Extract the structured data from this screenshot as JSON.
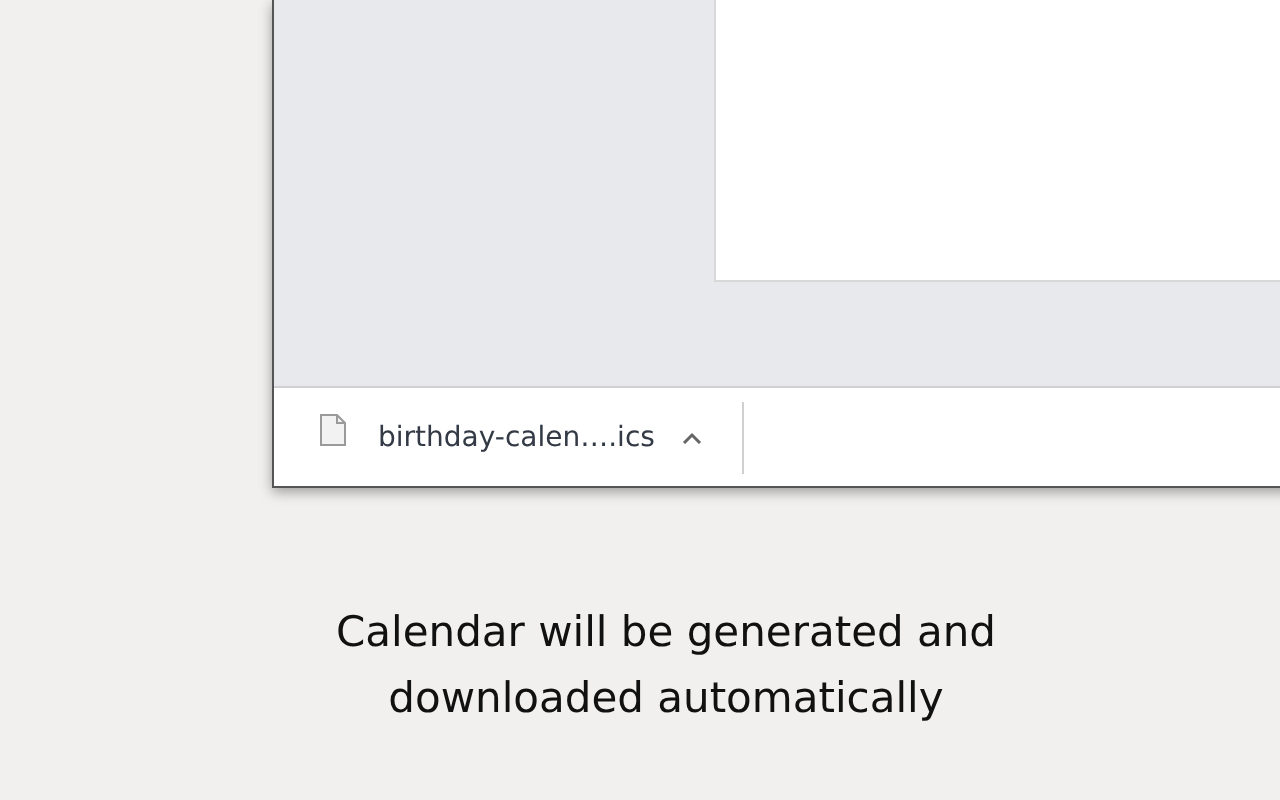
{
  "download_bar": {
    "items": [
      {
        "filename": "birthday-calen….ics"
      }
    ]
  },
  "caption": [
    "Calendar will be generated and",
    "downloaded automatically"
  ]
}
